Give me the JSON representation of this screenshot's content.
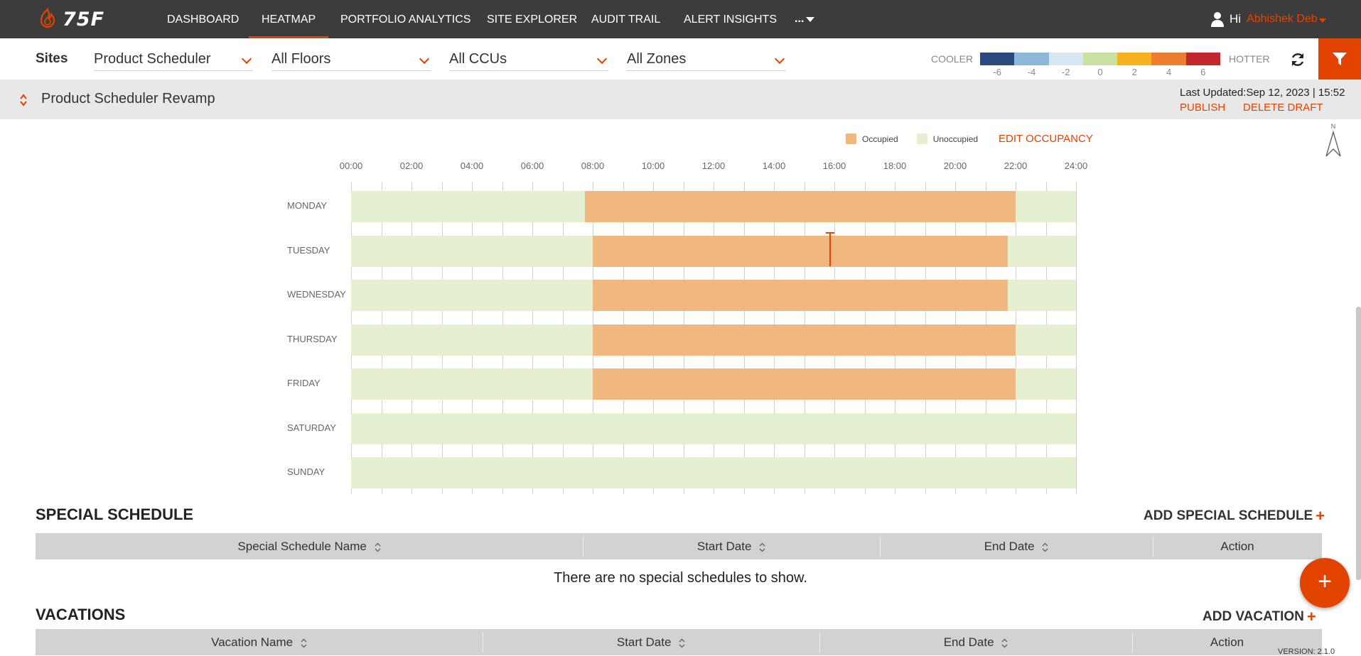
{
  "nav": {
    "brand": "75F",
    "items": [
      "DASHBOARD",
      "HEATMAP",
      "PORTFOLIO ANALYTICS",
      "SITE EXPLORER",
      "AUDIT TRAIL",
      "ALERT INSIGHTS"
    ],
    "active": "HEATMAP",
    "more_label": "...",
    "greeting": "Hi",
    "user_name": "Abhishek Deb"
  },
  "filters": {
    "sites_label": "Sites",
    "site": "Product Scheduler",
    "floors": "All Floors",
    "ccus": "All CCUs",
    "zones": "All Zones"
  },
  "temperature_legend": {
    "cooler_label": "COOLER",
    "hotter_label": "HOTTER",
    "colors": [
      "#2c4a7e",
      "#8db8d8",
      "#d6e6f3",
      "#c9e0a2",
      "#f6b21f",
      "#ef7d30",
      "#c0282c"
    ],
    "ticks": [
      "-6",
      "-4",
      "-2",
      "0",
      "2",
      "4",
      "6"
    ]
  },
  "schedule": {
    "name": "Product Scheduler Revamp",
    "last_updated_label": "Last Updated:",
    "last_updated_value": "Sep 12, 2023 | 15:52",
    "publish_label": "PUBLISH",
    "delete_draft_label": "DELETE DRAFT",
    "legend_occupied": "Occupied",
    "legend_unoccupied": "Unoccupied",
    "edit_occupancy_label": "EDIT OCCUPANCY",
    "occupied_color": "#f0b77e",
    "unoccupied_color": "#e4f0cf",
    "hour_labels": [
      "00:00",
      "02:00",
      "04:00",
      "06:00",
      "08:00",
      "10:00",
      "12:00",
      "14:00",
      "16:00",
      "18:00",
      "20:00",
      "22:00",
      "24:00"
    ],
    "days": [
      {
        "label": "MONDAY",
        "occupied_start": 7.75,
        "occupied_end": 22.0
      },
      {
        "label": "TUESDAY",
        "occupied_start": 8.0,
        "occupied_end": 21.75
      },
      {
        "label": "WEDNESDAY",
        "occupied_start": 8.0,
        "occupied_end": 21.75
      },
      {
        "label": "THURSDAY",
        "occupied_start": 8.0,
        "occupied_end": 22.0
      },
      {
        "label": "FRIDAY",
        "occupied_start": 8.0,
        "occupied_end": 22.0
      },
      {
        "label": "SATURDAY",
        "occupied_start": null,
        "occupied_end": null
      },
      {
        "label": "SUNDAY",
        "occupied_start": null,
        "occupied_end": null
      }
    ]
  },
  "special_schedule": {
    "title": "SPECIAL SCHEDULE",
    "add_label": "ADD SPECIAL SCHEDULE",
    "columns": [
      "Special Schedule Name",
      "Start Date",
      "End Date",
      "Action"
    ],
    "empty_message": "There are no special schedules to show."
  },
  "vacations": {
    "title": "VACATIONS",
    "add_label": "ADD VACATION",
    "columns": [
      "Vacation Name",
      "Start Date",
      "End Date",
      "Action"
    ]
  },
  "fab_label": "+",
  "version_text": "VERSION: 2.1.0"
}
